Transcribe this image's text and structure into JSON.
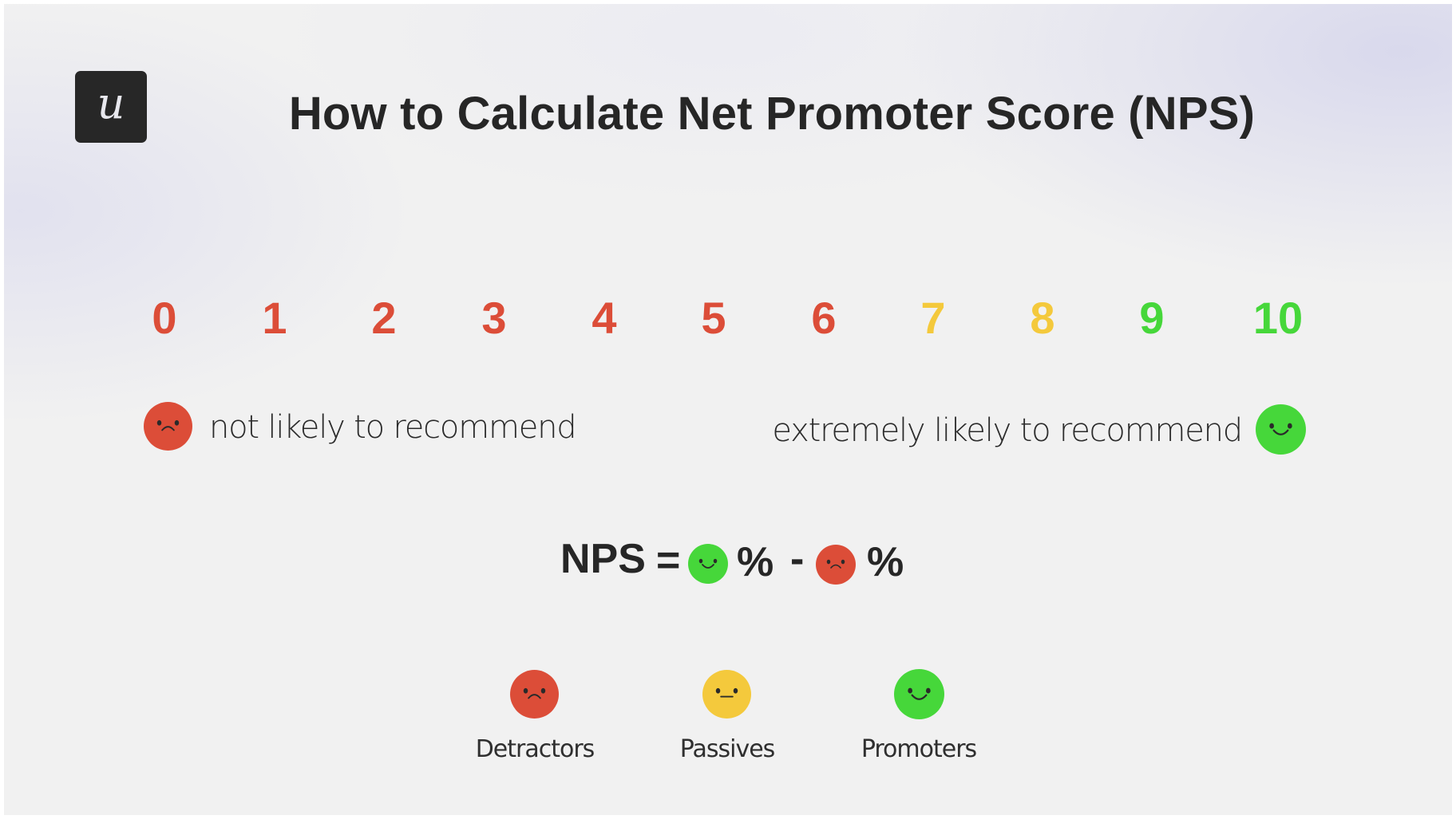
{
  "logo": {
    "letter": "u"
  },
  "title": "How to Calculate Net Promoter Score (NPS)",
  "colors": {
    "detractor": "#dc4d38",
    "passive": "#f4c93c",
    "promoter": "#46d73a",
    "text": "#262626"
  },
  "scale": {
    "numbers": [
      {
        "label": "0",
        "group": "detractor"
      },
      {
        "label": "1",
        "group": "detractor"
      },
      {
        "label": "2",
        "group": "detractor"
      },
      {
        "label": "3",
        "group": "detractor"
      },
      {
        "label": "4",
        "group": "detractor"
      },
      {
        "label": "5",
        "group": "detractor"
      },
      {
        "label": "6",
        "group": "detractor"
      },
      {
        "label": "7",
        "group": "passive"
      },
      {
        "label": "8",
        "group": "passive"
      },
      {
        "label": "9",
        "group": "promoter"
      },
      {
        "label": "10",
        "group": "promoter"
      }
    ],
    "low_label": "not likely to recommend",
    "high_label": "extremely likely to recommend"
  },
  "formula": {
    "lhs": "NPS",
    "equals": "=",
    "percent1": "%",
    "minus": "-",
    "percent2": "%"
  },
  "legend": [
    {
      "label": "Detractors",
      "face": "sad"
    },
    {
      "label": "Passives",
      "face": "neutral"
    },
    {
      "label": "Promoters",
      "face": "happy"
    }
  ]
}
